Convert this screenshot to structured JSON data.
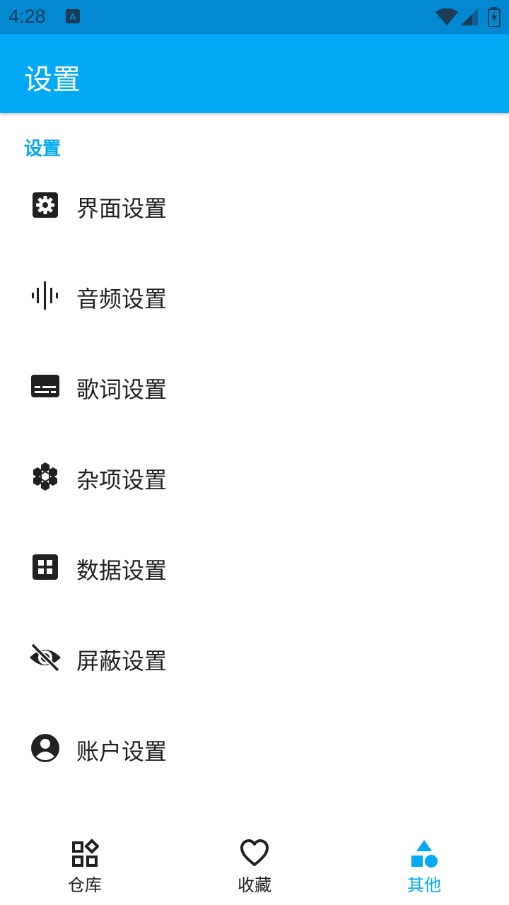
{
  "status_bar": {
    "time": "4:28"
  },
  "app_bar": {
    "title": "设置"
  },
  "section": {
    "header": "设置"
  },
  "settings": [
    {
      "label": "界面设置",
      "icon": "gear-icon"
    },
    {
      "label": "音频设置",
      "icon": "audio-wave-icon"
    },
    {
      "label": "歌词设置",
      "icon": "subtitles-icon"
    },
    {
      "label": "杂项设置",
      "icon": "hexagons-icon"
    },
    {
      "label": "数据设置",
      "icon": "grid-icon"
    },
    {
      "label": "屏蔽设置",
      "icon": "eye-off-icon"
    },
    {
      "label": "账户设置",
      "icon": "account-circle-icon"
    }
  ],
  "bottom_nav": {
    "items": [
      {
        "label": "仓库",
        "icon": "widgets-icon",
        "active": false
      },
      {
        "label": "收藏",
        "icon": "heart-icon",
        "active": false
      },
      {
        "label": "其他",
        "icon": "shapes-icon",
        "active": true
      }
    ]
  },
  "colors": {
    "primary": "#03a9f4",
    "status_bar": "#0288d1",
    "text": "#212121"
  }
}
